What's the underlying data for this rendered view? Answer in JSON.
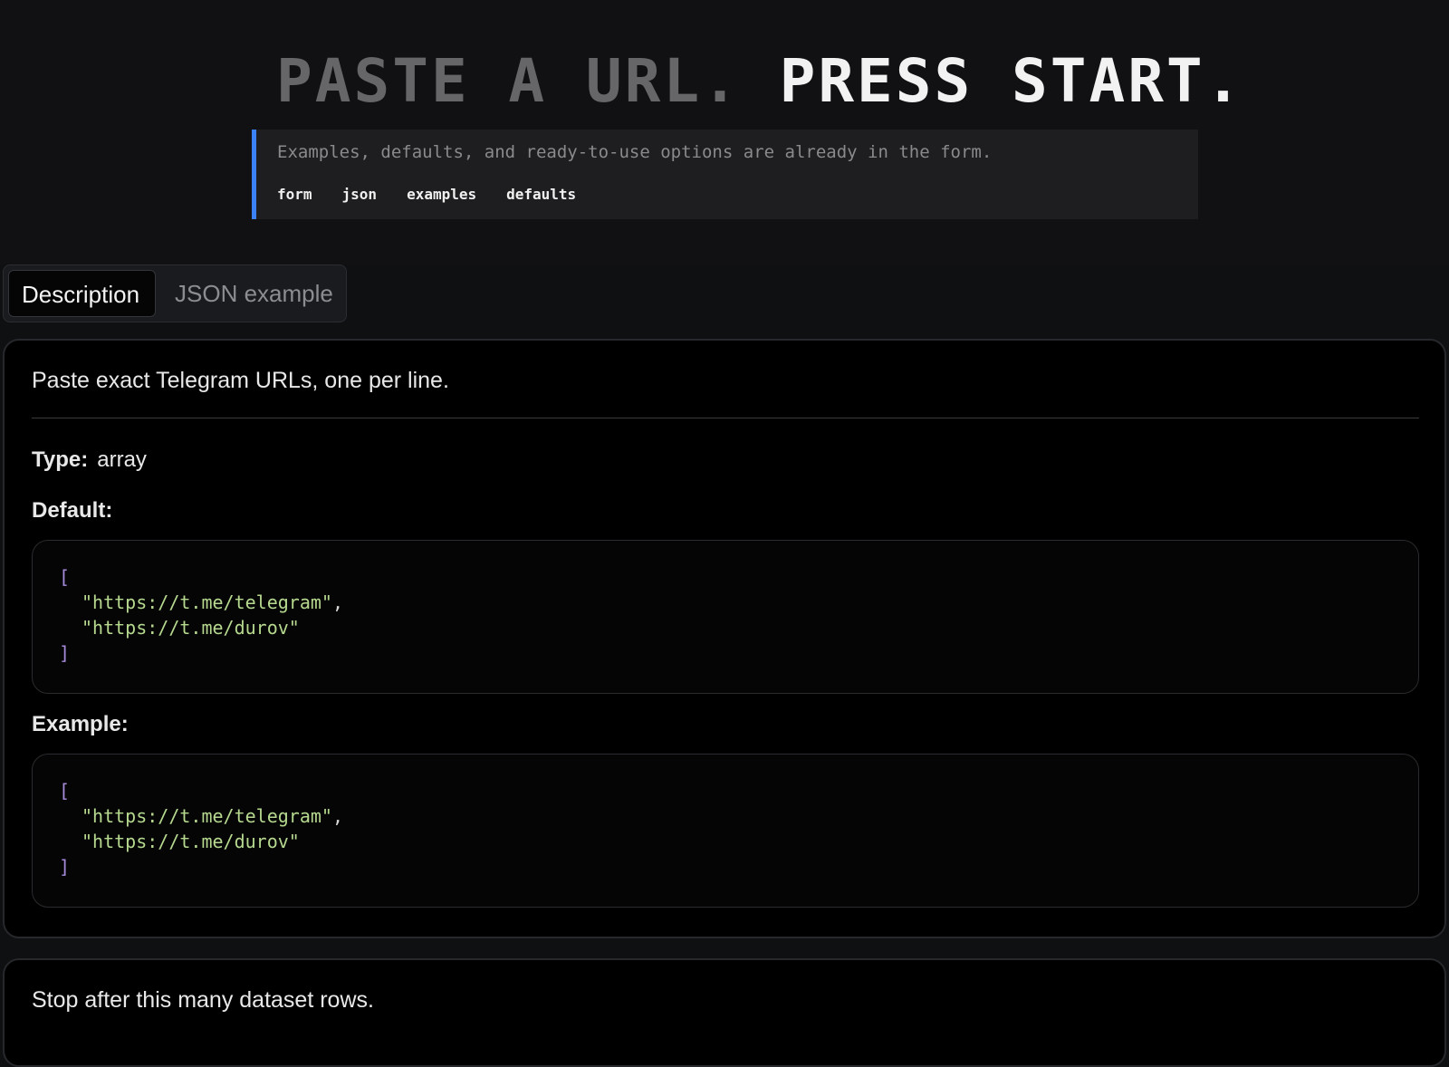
{
  "hero": {
    "headline_dim": "PASTE A URL.",
    "headline_bright": "PRESS START.",
    "callout_text": "Examples, defaults, and ready-to-use options are already in the form.",
    "callout_links": [
      "form",
      "json",
      "examples",
      "defaults"
    ]
  },
  "tabs": {
    "active": "Description",
    "inactive": "JSON example"
  },
  "field1": {
    "description": "Paste exact Telegram URLs, one per line.",
    "type_label": "Type:",
    "type_value": "array",
    "default_label": "Default:",
    "example_label": "Example:",
    "default_code": {
      "open": "[",
      "items": [
        "\"https://t.me/telegram\"",
        "\"https://t.me/durov\""
      ],
      "separators": [
        ",",
        ""
      ],
      "close": "]"
    },
    "example_code": {
      "open": "[",
      "items": [
        "\"https://t.me/telegram\"",
        "\"https://t.me/durov\""
      ],
      "separators": [
        ",",
        ""
      ],
      "close": "]"
    }
  },
  "field2": {
    "description": "Stop after this many dataset rows."
  },
  "colors": {
    "accent": "#3b82f6",
    "code_bracket": "#a78bda",
    "code_string": "#b6d98f"
  }
}
